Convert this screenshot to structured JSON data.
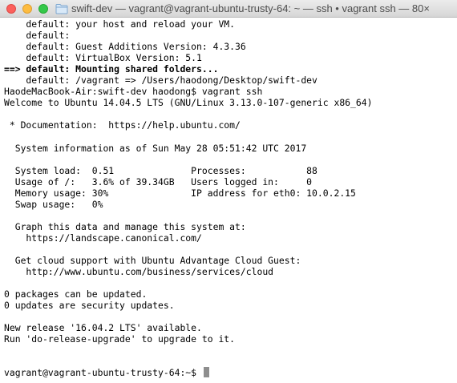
{
  "window": {
    "title": "swift-dev — vagrant@vagrant-ubuntu-trusty-64: ~ — ssh • vagrant ssh — 80×"
  },
  "terminal": {
    "lines": [
      {
        "text": "    default: your host and reload your VM.",
        "bold": false
      },
      {
        "text": "    default:",
        "bold": false
      },
      {
        "text": "    default: Guest Additions Version: 4.3.36",
        "bold": false
      },
      {
        "text": "    default: VirtualBox Version: 5.1",
        "bold": false
      },
      {
        "text": "==> default: Mounting shared folders...",
        "bold": true
      },
      {
        "text": "    default: /vagrant => /Users/haodong/Desktop/swift-dev",
        "bold": false
      },
      {
        "text": "HaodeMacBook-Air:swift-dev haodong$ vagrant ssh",
        "bold": false
      },
      {
        "text": "Welcome to Ubuntu 14.04.5 LTS (GNU/Linux 3.13.0-107-generic x86_64)",
        "bold": false
      },
      {
        "text": "",
        "bold": false
      },
      {
        "text": " * Documentation:  https://help.ubuntu.com/",
        "bold": false
      },
      {
        "text": "",
        "bold": false
      },
      {
        "text": "  System information as of Sun May 28 05:51:42 UTC 2017",
        "bold": false
      },
      {
        "text": "",
        "bold": false
      },
      {
        "text": "  System load:  0.51              Processes:           88",
        "bold": false
      },
      {
        "text": "  Usage of /:   3.6% of 39.34GB   Users logged in:     0",
        "bold": false
      },
      {
        "text": "  Memory usage: 30%               IP address for eth0: 10.0.2.15",
        "bold": false
      },
      {
        "text": "  Swap usage:   0%",
        "bold": false
      },
      {
        "text": "",
        "bold": false
      },
      {
        "text": "  Graph this data and manage this system at:",
        "bold": false
      },
      {
        "text": "    https://landscape.canonical.com/",
        "bold": false
      },
      {
        "text": "",
        "bold": false
      },
      {
        "text": "  Get cloud support with Ubuntu Advantage Cloud Guest:",
        "bold": false
      },
      {
        "text": "    http://www.ubuntu.com/business/services/cloud",
        "bold": false
      },
      {
        "text": "",
        "bold": false
      },
      {
        "text": "0 packages can be updated.",
        "bold": false
      },
      {
        "text": "0 updates are security updates.",
        "bold": false
      },
      {
        "text": "",
        "bold": false
      },
      {
        "text": "New release '16.04.2 LTS' available.",
        "bold": false
      },
      {
        "text": "Run 'do-release-upgrade' to upgrade to it.",
        "bold": false
      },
      {
        "text": "",
        "bold": false
      },
      {
        "text": "",
        "bold": false
      },
      {
        "text": "vagrant@vagrant-ubuntu-trusty-64:~$",
        "bold": false
      }
    ]
  },
  "icons": {
    "close": "close-button",
    "minimize": "minimize-button",
    "zoom": "zoom-button",
    "folder": "folder-icon"
  },
  "colors": {
    "close": "#fc605c",
    "minimize": "#fdbc40",
    "zoom": "#34c84a",
    "cursor": "#8e8e8e",
    "text": "#000000",
    "background": "#ffffff"
  }
}
